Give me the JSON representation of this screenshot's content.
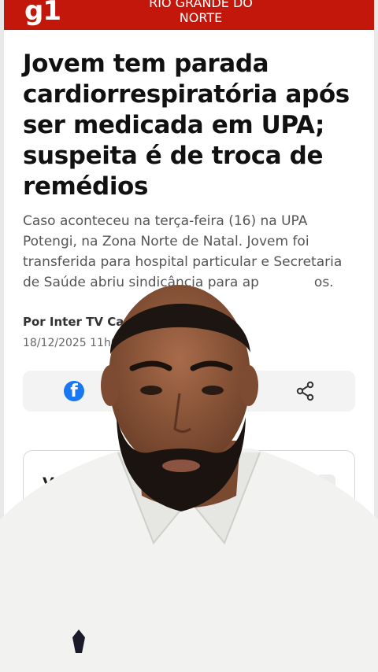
{
  "header": {
    "logo": "g1",
    "region_line1": "RIO GRANDE DO",
    "region_line2": "NORTE"
  },
  "article": {
    "headline": "Jovem tem parada cardiorrespiratória após ser medicada em UPA; suspeita é de troca de remédios",
    "subtitle": "Caso aconteceu na terça-feira (16) na UPA Potengi, na Zona Norte de Natal. Jovem foi transferida para hospital particular e Secretaria de Saúde abriu sindicância para ap",
    "subtitle_tail": "os.",
    "author": "Por Inter TV Ca",
    "date": "18/12/2025 11h0"
  },
  "share": {
    "facebook_icon": "facebook-icon",
    "share_icon": "share-icon"
  },
  "related": {
    "label": "Ver re"
  },
  "colors": {
    "brand": "#c4170c",
    "facebook": "#1877f2"
  }
}
